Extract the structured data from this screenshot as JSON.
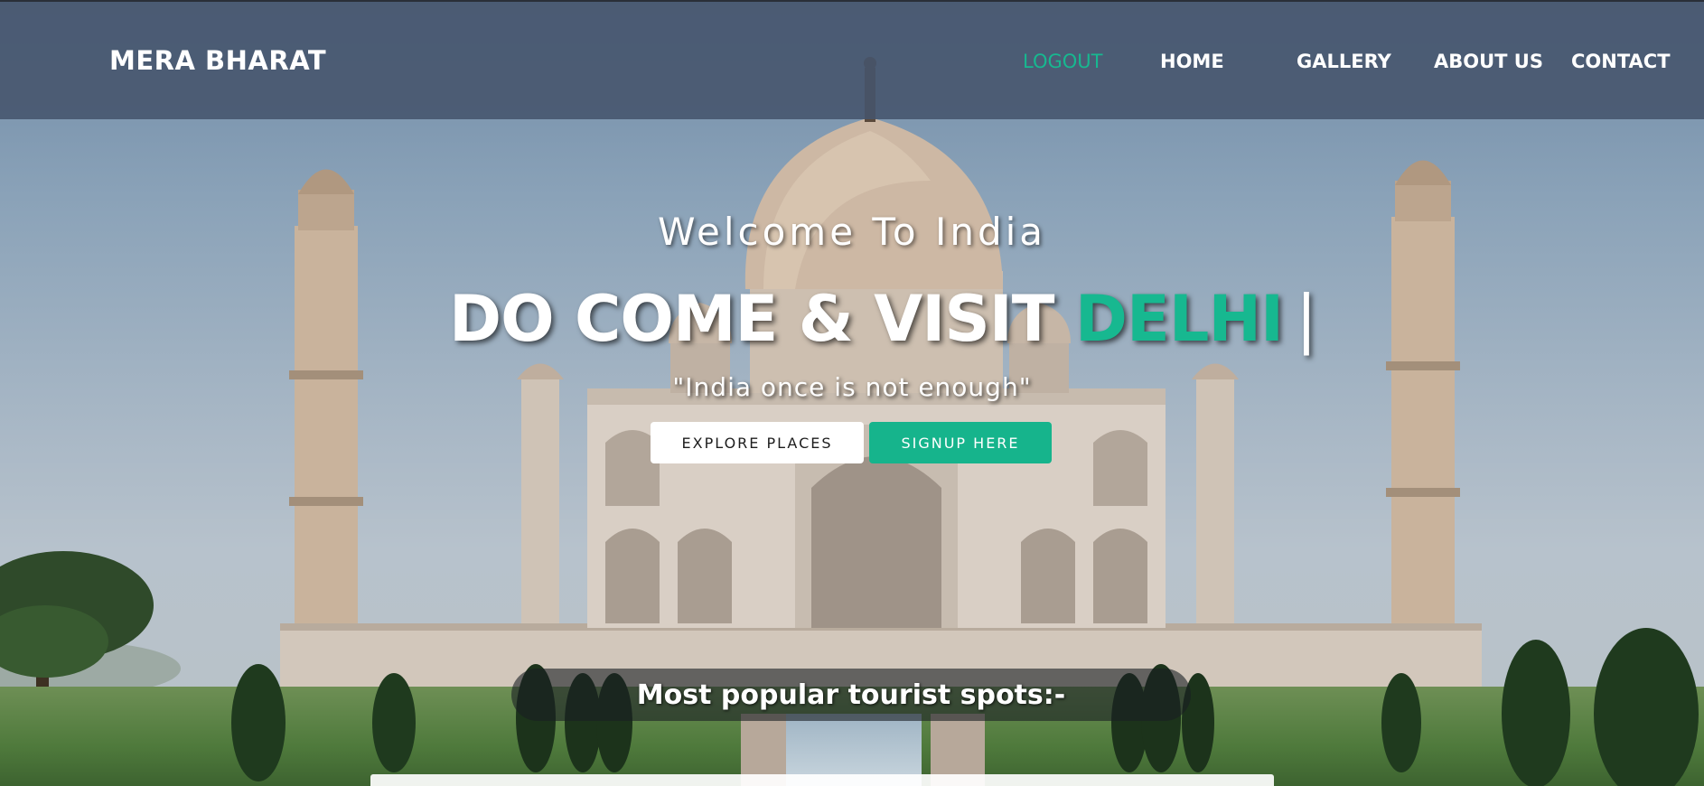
{
  "nav": {
    "brand": "MERA BHARAT",
    "links": [
      {
        "label": "LOGOUT",
        "active": true
      },
      {
        "label": "HOME"
      },
      {
        "label": "GALLERY"
      },
      {
        "label": "ABOUT US"
      },
      {
        "label": "CONTACT"
      }
    ]
  },
  "hero": {
    "welcome": "Welcome To India",
    "headline_prefix": "DO COME & VISIT ",
    "headline_city": "DELHI",
    "headline_caret": "|",
    "quote": "\"India once is not enough\"",
    "explore_label": "EXPLORE PLACES",
    "signup_label": "SIGNUP HERE"
  },
  "popular": {
    "title": "Most popular tourist spots:-"
  },
  "colors": {
    "accent": "#17b890",
    "navbar": "#46546c"
  }
}
